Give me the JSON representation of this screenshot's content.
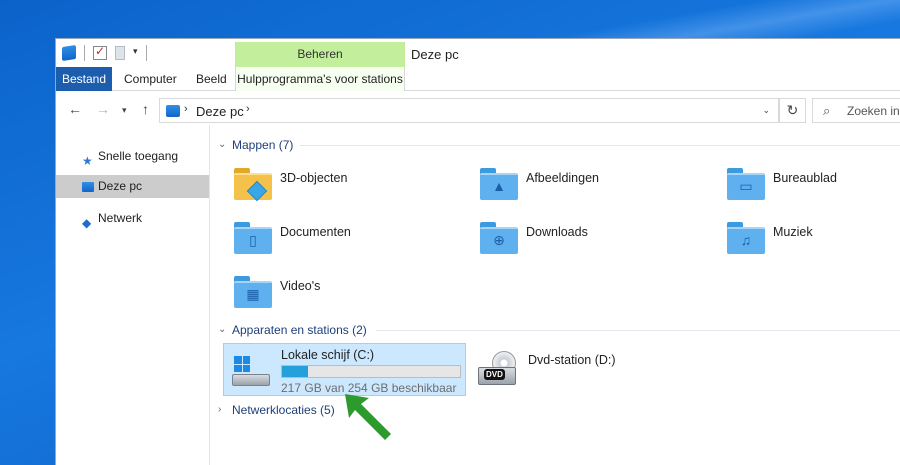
{
  "window": {
    "title": "Deze pc"
  },
  "ribbon": {
    "context_group": "Beheren",
    "tabs": {
      "file": "Bestand",
      "computer": "Computer",
      "view": "Beeld",
      "drive_tools": "Hulpprogramma's voor stations"
    }
  },
  "address": {
    "crumb": "Deze pc"
  },
  "search": {
    "placeholder": "Zoeken in"
  },
  "nav": {
    "quick_access": "Snelle toegang",
    "this_pc": "Deze pc",
    "network": "Netwerk"
  },
  "groups": {
    "folders": {
      "title": "Mappen (7)"
    },
    "devices": {
      "title": "Apparaten en stations (2)"
    },
    "network_locations": {
      "title": "Netwerklocaties (5)"
    }
  },
  "folders": [
    {
      "label": "3D-objecten",
      "icon": "3d-objects-folder-icon"
    },
    {
      "label": "Afbeeldingen",
      "icon": "pictures-folder-icon"
    },
    {
      "label": "Bureaublad",
      "icon": "desktop-folder-icon"
    },
    {
      "label": "Documenten",
      "icon": "documents-folder-icon"
    },
    {
      "label": "Downloads",
      "icon": "downloads-folder-icon"
    },
    {
      "label": "Muziek",
      "icon": "music-folder-icon"
    },
    {
      "label": "Video's",
      "icon": "videos-folder-icon"
    }
  ],
  "drives": {
    "c": {
      "name": "Lokale schijf (C:)",
      "free_text": "217 GB van 254 GB beschikbaar",
      "used_fraction": 0.146
    },
    "d": {
      "name": "Dvd-station (D:)",
      "badge": "DVD"
    }
  },
  "colors": {
    "accent": "#1c5dae",
    "selection": "#cce8ff",
    "usage_bar": "#26a0da",
    "context_tab": "#c3ef9c",
    "arrow": "#2d9a2d"
  }
}
